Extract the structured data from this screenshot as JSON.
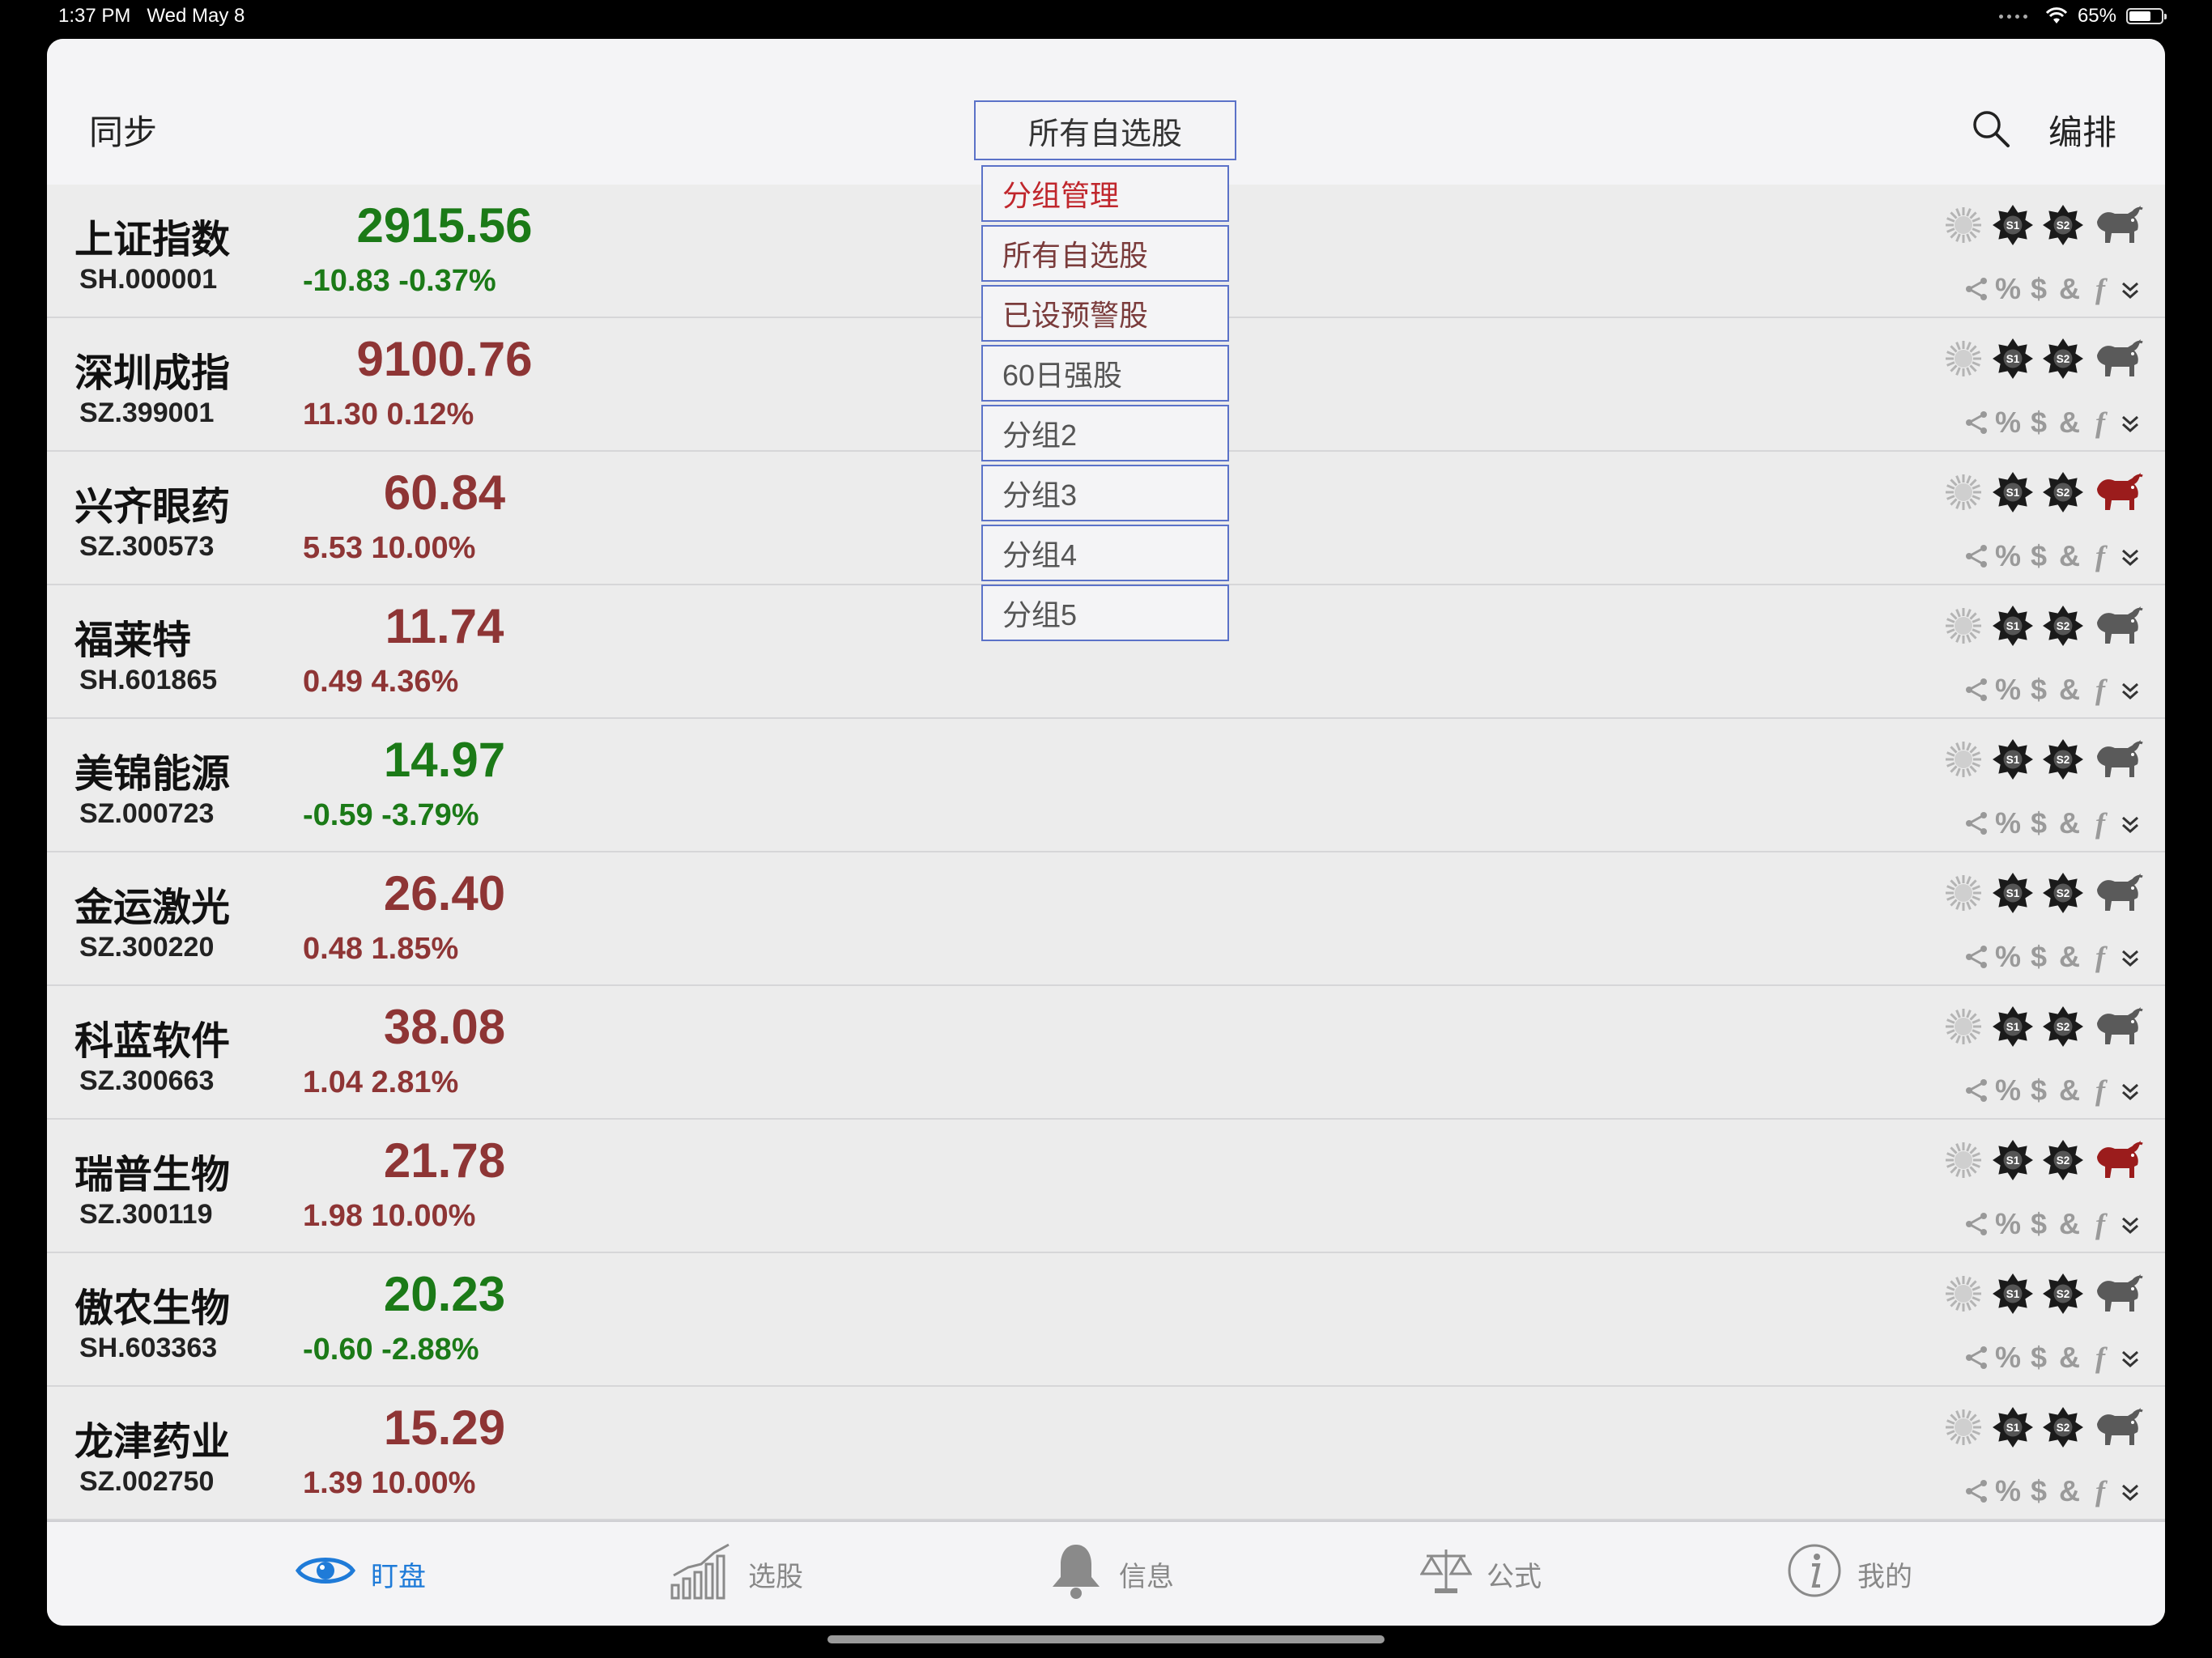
{
  "status_bar": {
    "time": "1:37 PM",
    "date": "Wed May 8",
    "battery": "65%",
    "battery_level": 0.65
  },
  "nav": {
    "left": "同步",
    "title": "所有自选股",
    "right": "编排"
  },
  "dropdown": [
    {
      "label": "分组管理",
      "style": "red"
    },
    {
      "label": "所有自选股",
      "style": "brown"
    },
    {
      "label": "已设预警股",
      "style": "brown"
    },
    {
      "label": "60日强股",
      "style": "gray"
    },
    {
      "label": "分组2",
      "style": "gray"
    },
    {
      "label": "分组3",
      "style": "gray"
    },
    {
      "label": "分组4",
      "style": "gray"
    },
    {
      "label": "分组5",
      "style": "gray"
    }
  ],
  "stocks": [
    {
      "name": "上证指数",
      "code": "SH.000001",
      "price": "2915.56",
      "change": "-10.83 -0.37%",
      "dir": "down",
      "bull_active": false
    },
    {
      "name": "深圳成指",
      "code": "SZ.399001",
      "price": "9100.76",
      "change": "11.30 0.12%",
      "dir": "up",
      "bull_active": false
    },
    {
      "name": "兴齐眼药",
      "code": "SZ.300573",
      "price": "60.84",
      "change": "5.53 10.00%",
      "dir": "up",
      "bull_active": true
    },
    {
      "name": "福莱特",
      "code": "SH.601865",
      "price": "11.74",
      "change": "0.49 4.36%",
      "dir": "up",
      "bull_active": false
    },
    {
      "name": "美锦能源",
      "code": "SZ.000723",
      "price": "14.97",
      "change": "-0.59 -3.79%",
      "dir": "down",
      "bull_active": false
    },
    {
      "name": "金运激光",
      "code": "SZ.300220",
      "price": "26.40",
      "change": "0.48 1.85%",
      "dir": "up",
      "bull_active": false
    },
    {
      "name": "科蓝软件",
      "code": "SZ.300663",
      "price": "38.08",
      "change": "1.04 2.81%",
      "dir": "up",
      "bull_active": false
    },
    {
      "name": "瑞普生物",
      "code": "SZ.300119",
      "price": "21.78",
      "change": "1.98 10.00%",
      "dir": "up",
      "bull_active": true
    },
    {
      "name": "傲农生物",
      "code": "SH.603363",
      "price": "20.23",
      "change": "-0.60 -2.88%",
      "dir": "down",
      "bull_active": false
    },
    {
      "name": "龙津药业",
      "code": "SZ.002750",
      "price": "15.29",
      "change": "1.39 10.00%",
      "dir": "up",
      "bull_active": false
    }
  ],
  "row_icons": {
    "top": [
      "sun-icon",
      "s1-badge-icon",
      "s2-badge-icon",
      "bull-icon"
    ],
    "badges": [
      "S1",
      "S2"
    ],
    "bottom": [
      "share-icon",
      "%",
      "$",
      "&",
      "f",
      "double-chevron-down-icon"
    ]
  },
  "colors": {
    "up": "#8e3535",
    "down": "#1b7a17",
    "active_tab": "#1f7bd8",
    "dropdown_border": "#5b72c8",
    "bull_active": "#9b1c1c"
  },
  "tabs": [
    {
      "label": "盯盘",
      "icon": "eye-icon",
      "active": true
    },
    {
      "label": "选股",
      "icon": "chart-icon",
      "active": false
    },
    {
      "label": "信息",
      "icon": "bell-icon",
      "active": false
    },
    {
      "label": "公式",
      "icon": "scales-icon",
      "active": false
    },
    {
      "label": "我的",
      "icon": "info-icon",
      "active": false
    }
  ]
}
